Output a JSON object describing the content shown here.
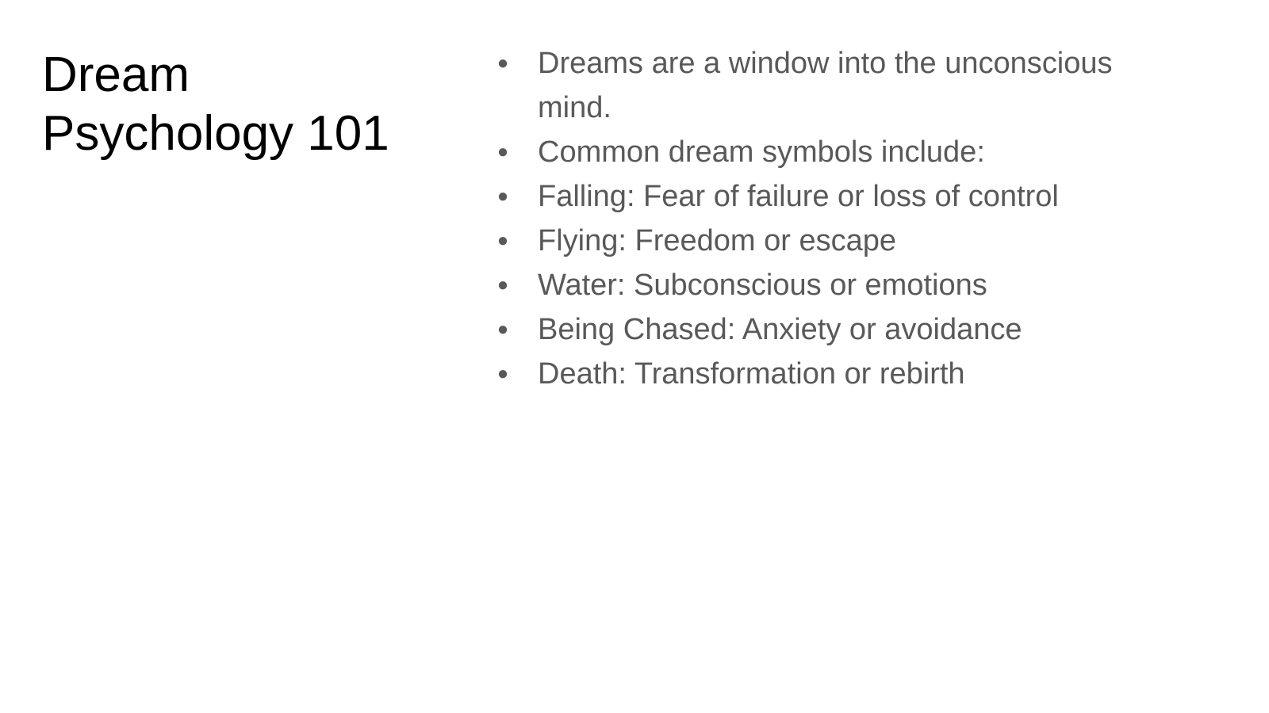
{
  "slide": {
    "title": "Dream Psychology 101",
    "bullets": [
      "Dreams are a window into the unconscious mind.",
      "Common dream symbols include:",
      "Falling: Fear of failure or loss of control",
      "Flying: Freedom or escape",
      "Water: Subconscious or emotions",
      "Being Chased: Anxiety or avoidance",
      "Death: Transformation or rebirth"
    ],
    "bullet_glyph": "●"
  },
  "colors": {
    "title": "#000000",
    "body": "#595959",
    "background": "#ffffff"
  }
}
